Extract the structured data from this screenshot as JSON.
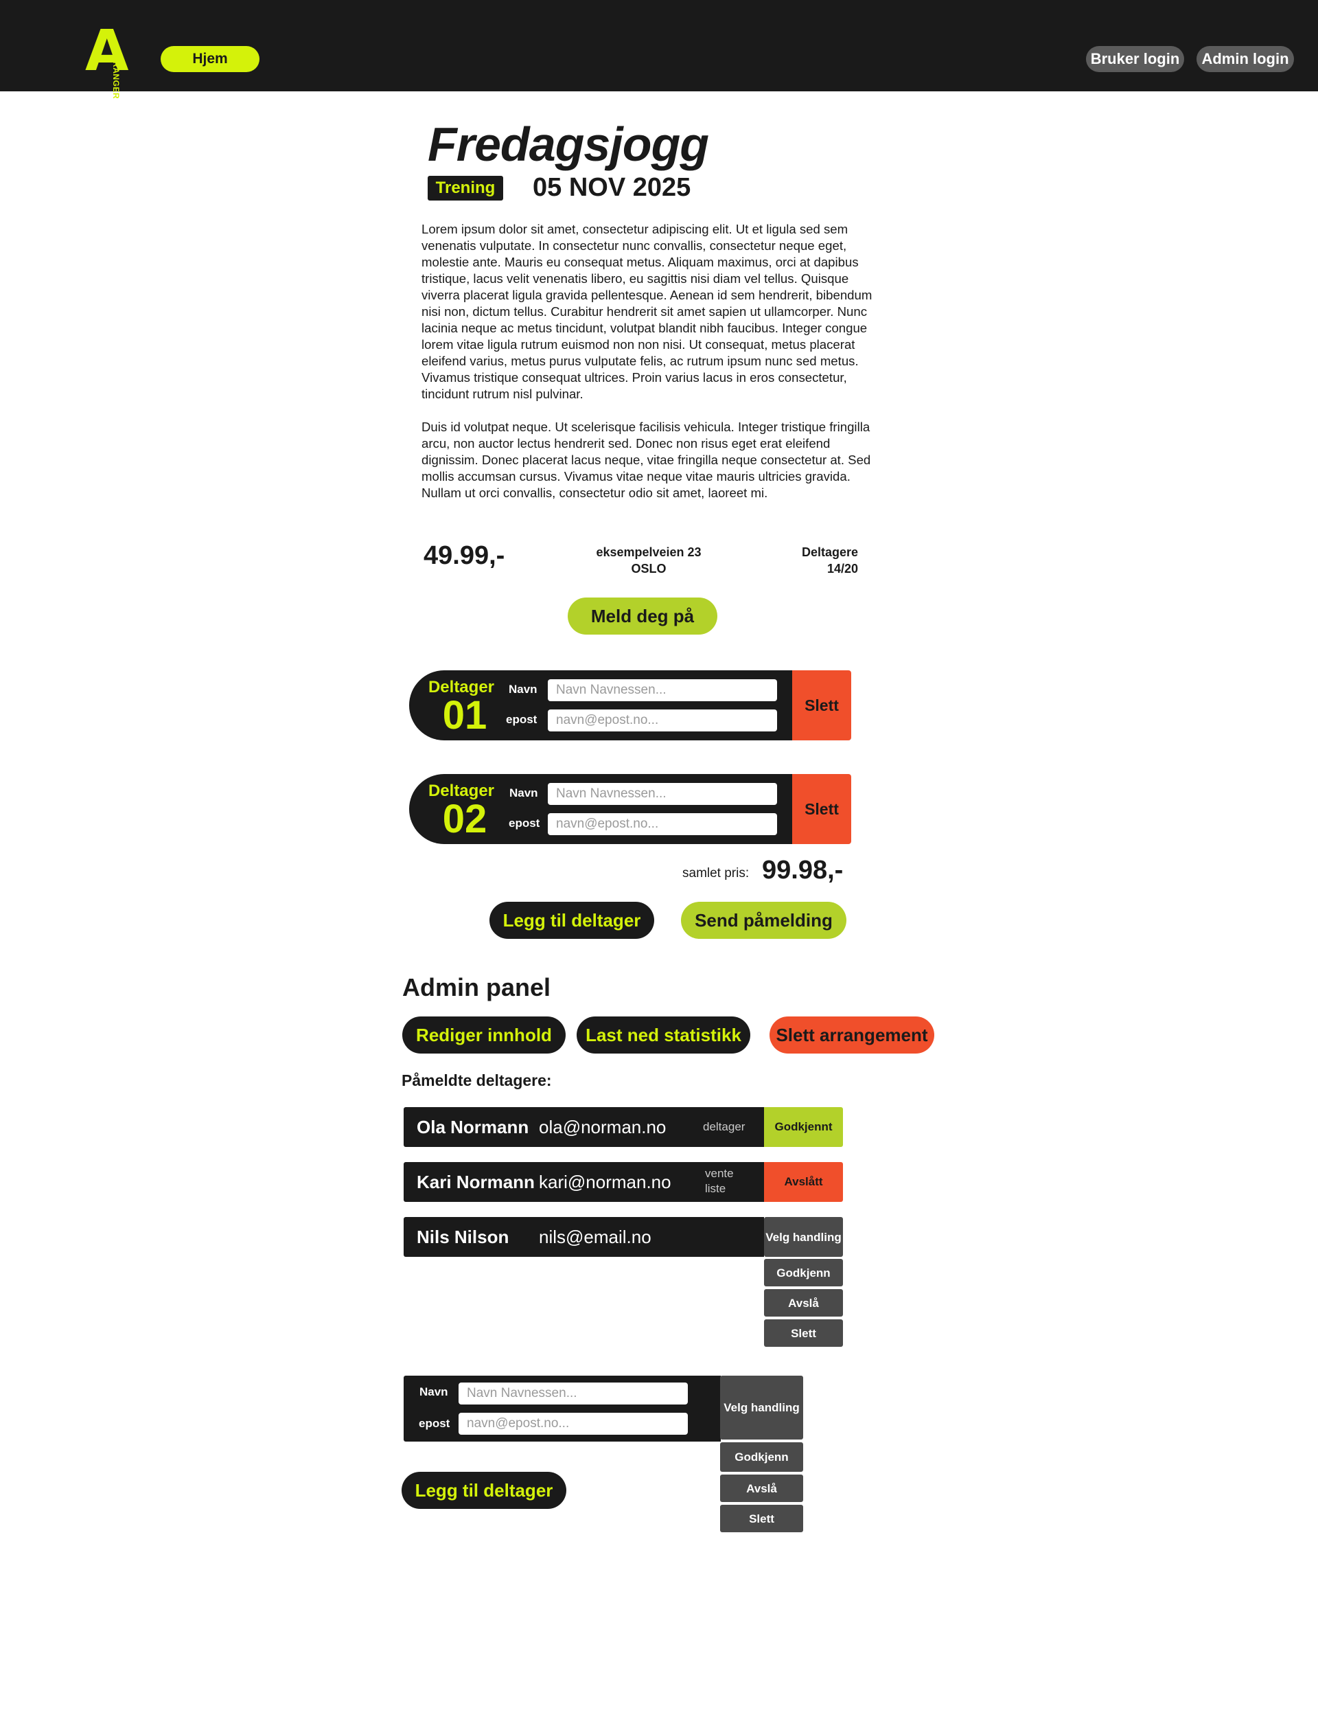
{
  "header": {
    "logo_letter": "A",
    "logo_text": "ARANGER",
    "home": "Hjem",
    "user_login": "Bruker login",
    "admin_login": "Admin login"
  },
  "event": {
    "title": "Fredagsjogg",
    "category": "Trening",
    "date": "05 NOV 2025",
    "description": [
      " Lorem ipsum dolor sit amet, consectetur adipiscing elit. Ut et ligula sed sem venenatis vulputate. In consectetur nunc convallis, consectetur neque eget, molestie ante. Mauris eu consequat metus. Aliquam maximus, orci at dapibus tristique, lacus velit venenatis libero, eu sagittis nisi diam vel tellus. Quisque viverra placerat ligula gravida pellentesque. Aenean id sem hendrerit, bibendum nisi non, dictum tellus. Curabitur hendrerit sit amet sapien ut ullamcorper. Nunc lacinia neque ac metus tincidunt, volutpat blandit nibh faucibus. Integer congue lorem vitae ligula rutrum euismod non non nisi. Ut consequat, metus placerat eleifend varius, metus purus vulputate felis, ac rutrum ipsum nunc sed metus. Vivamus tristique consequat ultrices. Proin varius lacus in eros consectetur, tincidunt rutrum nisl pulvinar.",
      "Duis id volutpat neque. Ut scelerisque facilisis vehicula. Integer tristique fringilla arcu, non auctor lectus hendrerit sed. Donec non risus eget erat eleifend dignissim. Donec placerat lacus neque, vitae fringilla neque consectetur at. Sed mollis accumsan cursus. Vivamus vitae neque vitae mauris ultricies gravida. Nullam ut orci convallis, consectetur odio sit amet, laoreet mi."
    ],
    "price": "49.99,-",
    "address_line1": "eksempelveien 23",
    "address_line2": "OSLO",
    "participants_label": "Deltagere",
    "participants_count": "14/20",
    "signup_button": "Meld deg på"
  },
  "signup_form": {
    "participants": [
      {
        "label": "Deltager",
        "number": "01",
        "name_label": "Navn",
        "name_placeholder": "Navn Navnessen...",
        "email_label": "epost",
        "email_placeholder": "navn@epost.no...",
        "delete": "Slett"
      },
      {
        "label": "Deltager",
        "number": "02",
        "name_label": "Navn",
        "name_placeholder": "Navn Navnessen...",
        "email_label": "epost",
        "email_placeholder": "navn@epost.no...",
        "delete": "Slett"
      }
    ],
    "total_label": "samlet pris:",
    "total_value": "99.98,-",
    "add_participant": "Legg til deltager",
    "submit": "Send påmelding"
  },
  "admin": {
    "title": "Admin panel",
    "edit_content": "Rediger innhold",
    "download_stats": "Last ned statistikk",
    "delete_event": "Slett arrangement",
    "registered_title": "Påmeldte deltagere:",
    "registrations": [
      {
        "name": "Ola Normann",
        "email": "ola@norman.no",
        "role": "deltager",
        "status": "Godkjennt"
      },
      {
        "name": "Kari Normann",
        "email": "kari@norman.no",
        "role": "vente liste",
        "status": "Avslått"
      },
      {
        "name": "Nils Nilson",
        "email": "nils@email.no",
        "role": "",
        "status": ""
      }
    ],
    "action_menu": {
      "choose": "Velg handling",
      "approve": "Godkjenn",
      "reject": "Avslå",
      "delete": "Slett"
    },
    "new_participant": {
      "name_label": "Navn",
      "name_placeholder": "Navn Navnessen...",
      "email_label": "epost",
      "email_placeholder": "navn@epost.no..."
    },
    "add_participant": "Legg til deltager"
  },
  "colors": {
    "accent": "#d4f20a",
    "accent_muted": "#b3d12a",
    "danger": "#f04f2b",
    "dark": "#1a1a1a",
    "gray": "#4a4a4a"
  }
}
